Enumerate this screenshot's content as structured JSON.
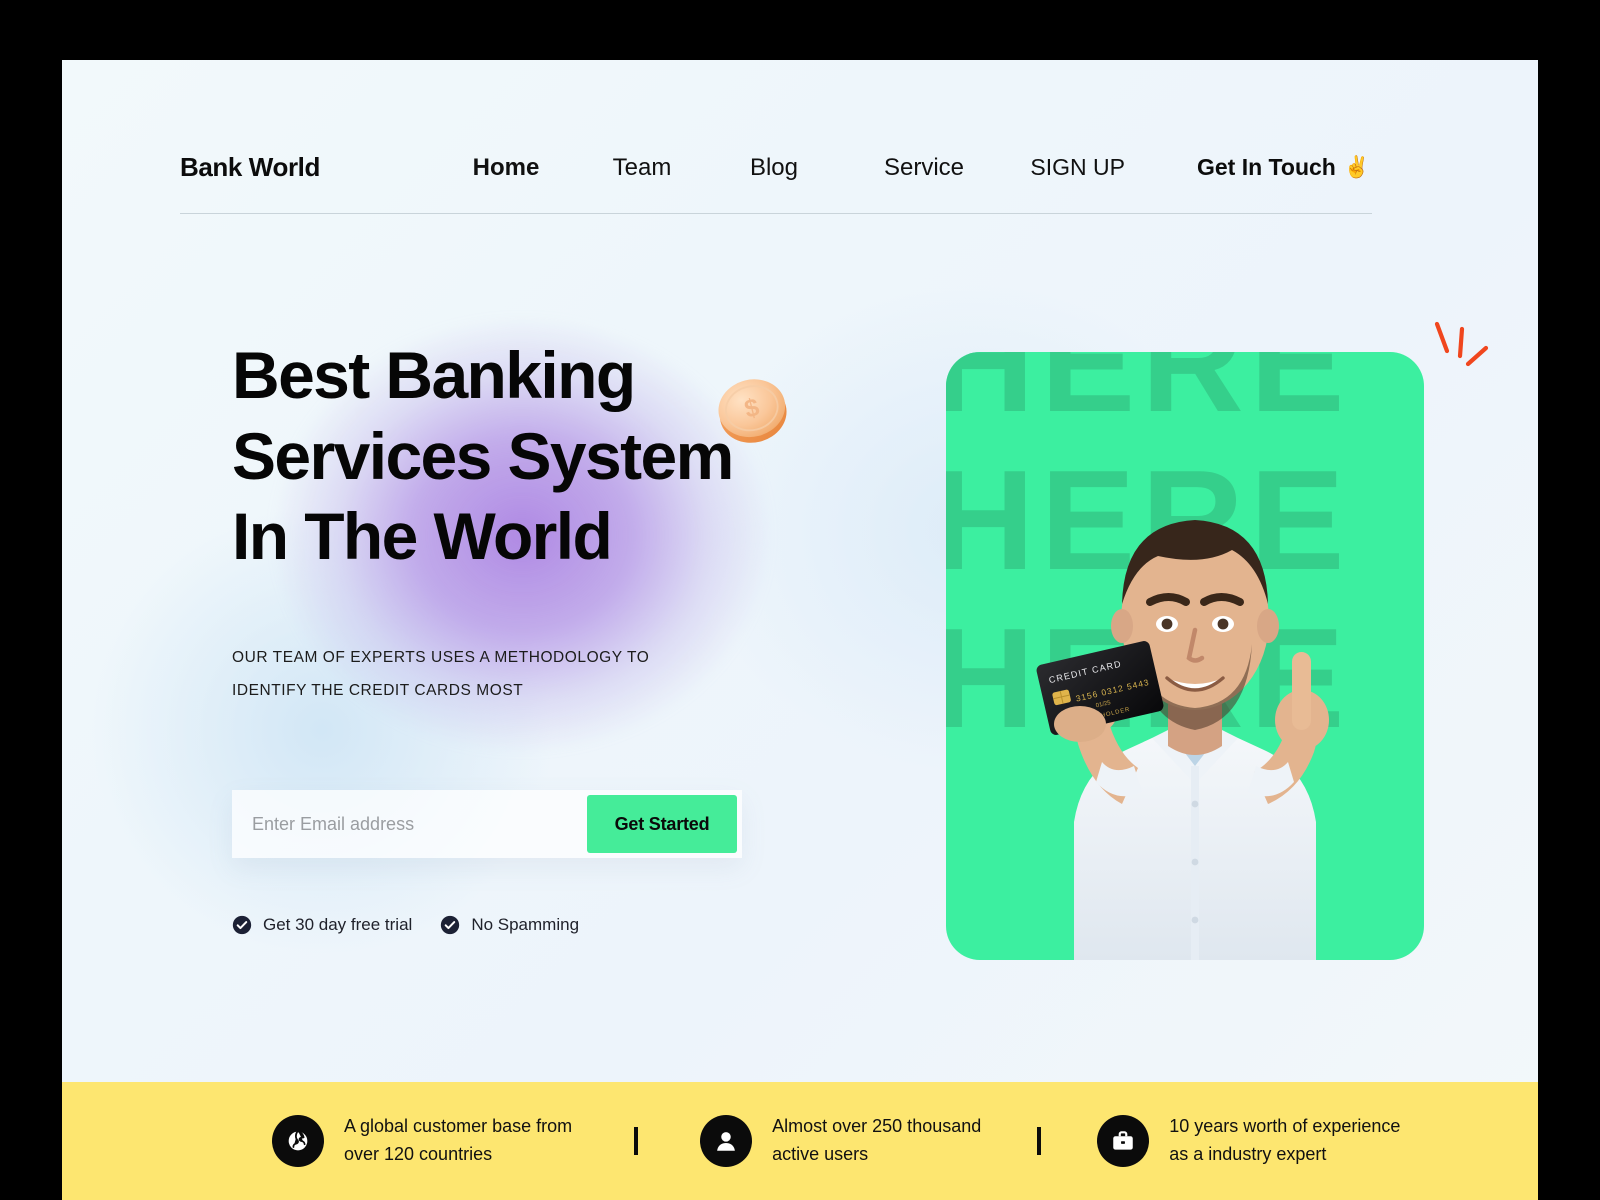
{
  "brand": {
    "name": "Bank World"
  },
  "nav": {
    "links": [
      {
        "label": "Home",
        "active": true
      },
      {
        "label": "Team",
        "active": false
      },
      {
        "label": "Blog",
        "active": false
      },
      {
        "label": "Service",
        "active": false
      }
    ],
    "signup_label": "SIGN UP",
    "contact_label": "Get In Touch",
    "contact_emoji": "✌️"
  },
  "hero": {
    "headline_line1": "Best Banking",
    "headline_line2": "Services System",
    "headline_line3": "In The World",
    "sub_line1": "OUR TEAM OF EXPERTS USES A METHODOLOGY TO",
    "sub_line2": "IDENTIFY THE CREDIT CARDS MOST",
    "coin_icon": "dollar-coin-icon",
    "sparks_icon": "spark-lines-icon"
  },
  "form": {
    "email_value": "",
    "email_placeholder": "Enter Email address",
    "cta_label": "Get Started"
  },
  "perks": [
    {
      "label": "Get 30 day free trial",
      "icon": "check-circle-icon"
    },
    {
      "label": "No Spamming",
      "icon": "check-circle-icon"
    }
  ],
  "hero_image": {
    "background_word": "HERE",
    "card_label": "CREDIT CARD",
    "card_number": "3156 0312 5443",
    "card_expiry": "01/25",
    "card_holder": "CARD HOLDER",
    "alt": "Smiling man in white shirt holding a black credit card and pointing up"
  },
  "stats": [
    {
      "icon": "globe-icon",
      "line1": "A global customer base from",
      "line2": "over 120 countries"
    },
    {
      "icon": "user-icon",
      "line1": "Almost over 250 thousand",
      "line2": "active users"
    },
    {
      "icon": "briefcase-icon",
      "line1": "10 years worth of experience",
      "line2": "as a industry expert"
    }
  ],
  "colors": {
    "accent_green": "#45EC99",
    "card_green": "#3CEFA0",
    "card_green_dark": "#35CF8B",
    "stats_yellow": "#FDE670",
    "blob_purple": "#AA80E1",
    "spark_orange": "#F0461E",
    "ink": "#0B0B0B"
  }
}
